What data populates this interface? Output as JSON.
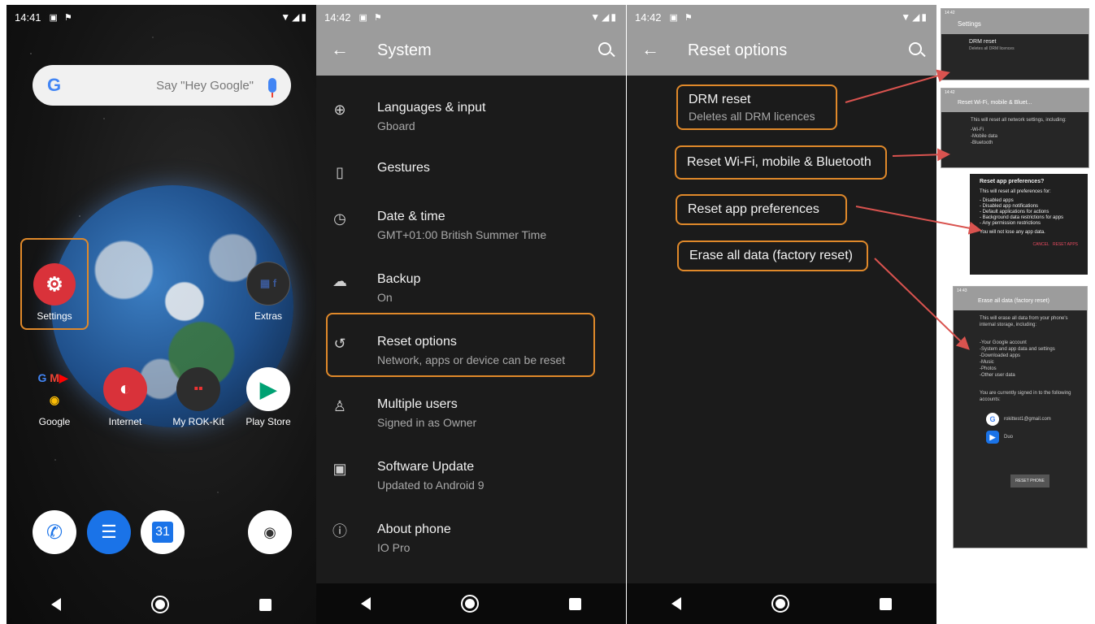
{
  "home": {
    "status_time": "14:41",
    "search_placeholder": "Say \"Hey Google\"",
    "apps": [
      {
        "label": "Settings"
      },
      {
        "label": "Extras"
      },
      {
        "label": "Google"
      },
      {
        "label": "Internet"
      },
      {
        "label": "My ROK-Kit"
      },
      {
        "label": "Play Store"
      }
    ],
    "calendar_day": "31"
  },
  "system": {
    "status_time": "14:42",
    "title": "System",
    "items": [
      {
        "label": "Languages & input",
        "sub": "Gboard",
        "icon": "globe-icon"
      },
      {
        "label": "Gestures",
        "sub": "",
        "icon": "gesture-phone-icon"
      },
      {
        "label": "Date & time",
        "sub": "GMT+01:00 British Summer Time",
        "icon": "clock-icon"
      },
      {
        "label": "Backup",
        "sub": "On",
        "icon": "cloud-upload-icon"
      },
      {
        "label": "Reset options",
        "sub": "Network, apps or device can be reset",
        "icon": "history-icon"
      },
      {
        "label": "Multiple users",
        "sub": "Signed in as Owner",
        "icon": "person-icon"
      },
      {
        "label": "Software Update",
        "sub": "Updated to Android 9",
        "icon": "system-update-icon"
      },
      {
        "label": "About phone",
        "sub": "IO Pro",
        "icon": "info-icon"
      }
    ]
  },
  "reset": {
    "status_time": "14:42",
    "title": "Reset options",
    "items": [
      {
        "label": "DRM reset",
        "sub": "Deletes all DRM licences"
      },
      {
        "label": "Reset Wi-Fi, mobile & Bluetooth"
      },
      {
        "label": "Reset app preferences"
      },
      {
        "label": "Erase all data (factory reset)"
      }
    ]
  },
  "thumbs": {
    "drm": {
      "status_time": "14:42",
      "title": "Settings",
      "label": "DRM reset",
      "sub": "Deletes all DRM licences"
    },
    "wifi": {
      "status_time": "14:42",
      "title": "Reset Wi-Fi, mobile & Bluet...",
      "intro": "This will reset all network settings, including:",
      "lines": [
        "-Wi-Fi",
        "-Mobile data",
        "-Bluetooth"
      ]
    },
    "prefs": {
      "title": "Reset app preferences?",
      "intro": "This will reset all preferences for:",
      "lines": [
        "- Disabled apps",
        "- Disabled app notifications",
        "- Default applications for actions",
        "- Background data restrictions for apps",
        "- Any permission restrictions"
      ],
      "note": "You will not lose any app data.",
      "cancel": "CANCEL",
      "confirm": "RESET APPS"
    },
    "erase": {
      "status_time": "14:43",
      "title": "Erase all data (factory reset)",
      "intro": "This will erase all data from your phone's internal storage, including:",
      "lines": [
        "-Your Google account",
        "-System and app data and settings",
        "-Downloaded apps",
        "-Music",
        "-Photos",
        "-Other user data"
      ],
      "accounts_intro": "You are currently signed in to the following accounts:",
      "account_google": "rokittest1@gmail.com",
      "account_duo": "Duo",
      "button": "RESET PHONE"
    }
  },
  "colors": {
    "highlight": "#e0892a",
    "arrow": "#d9534f",
    "toolbar": "#9c9c9c",
    "settings_bg": "#1b1b1b"
  }
}
